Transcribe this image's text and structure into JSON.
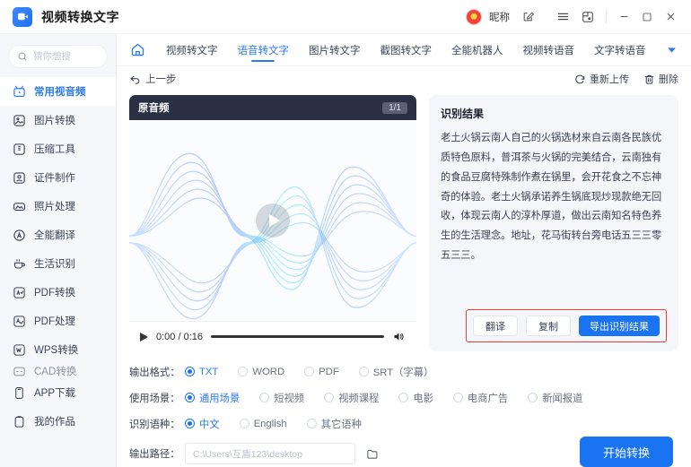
{
  "titlebar": {
    "app_title": "视频转换文字",
    "nickname": "昵称",
    "icons": [
      "edit-icon",
      "menu-icon",
      "window-snap-icon",
      "minimize-icon",
      "maximize-icon",
      "close-icon"
    ]
  },
  "sidebar": {
    "search": {
      "placeholder": "猜你想搜"
    },
    "items": [
      {
        "label": "常用视音频",
        "icon": "video-icon",
        "active": true
      },
      {
        "label": "图片转换",
        "icon": "image-icon",
        "active": false
      },
      {
        "label": "压缩工具",
        "icon": "compress-icon",
        "active": false
      },
      {
        "label": "证件制作",
        "icon": "id-card-icon",
        "active": false
      },
      {
        "label": "照片处理",
        "icon": "photo-icon",
        "active": false
      },
      {
        "label": "全能翻译",
        "icon": "translate-icon",
        "active": false
      },
      {
        "label": "生活识别",
        "icon": "life-icon",
        "active": false
      },
      {
        "label": "PDF转换",
        "icon": "pdf-convert-icon",
        "active": false
      },
      {
        "label": "PDF处理",
        "icon": "pdf-edit-icon",
        "active": false
      },
      {
        "label": "WPS转换",
        "icon": "wps-icon",
        "active": false
      },
      {
        "label": "CAD转换",
        "icon": "cad-icon",
        "active": false
      },
      {
        "label": "APP下载",
        "icon": "app-download-icon",
        "active": false
      },
      {
        "label": "我的作品",
        "icon": "my-works-icon",
        "active": false
      }
    ]
  },
  "tabs": [
    {
      "label": "视频转文字",
      "active": false
    },
    {
      "label": "语音转文字",
      "active": true
    },
    {
      "label": "图片转文字",
      "active": false
    },
    {
      "label": "截图转文字",
      "active": false
    },
    {
      "label": "全能机器人",
      "active": false
    },
    {
      "label": "视频转语音",
      "active": false
    },
    {
      "label": "文字转语音",
      "active": false
    }
  ],
  "toolbar": {
    "back_label": "上一步",
    "reupload_label": "重新上传",
    "delete_label": "删除"
  },
  "media": {
    "panel_title": "原音频",
    "page_indicator": "1/1",
    "current_time": "0:00",
    "duration": "0:16",
    "time_display": "0:00 / 0:16"
  },
  "result": {
    "title": "识别结果",
    "text": "老土火锅云南人自己的火锅选材来自云南各民族优质特色原料，普洱茶与火锅的完美结合，云南独有的食品豆腐特殊制作煮在锅里，会开花食之不忘神奇的体验。老土火锅承诺养生锅底现炒现款绝无回收，体现云南人的淳朴厚道，做出云南知名特色养生的生活理念。地址，花马街转台旁电话五三三零五三三。",
    "translate_label": "翻译",
    "copy_label": "复制",
    "export_label": "导出识别结果"
  },
  "options": {
    "format": {
      "label": "输出格式：",
      "choices": [
        "TXT",
        "WORD",
        "PDF",
        "SRT（字幕）"
      ],
      "selected": "TXT"
    },
    "scene": {
      "label": "使用场景：",
      "choices": [
        "通用场景",
        "短视频",
        "视频课程",
        "电影",
        "电商广告",
        "新闻报道"
      ],
      "selected": "通用场景"
    },
    "language": {
      "label": "识别语种：",
      "choices": [
        "中文",
        "English",
        "其它语种"
      ],
      "selected": "中文"
    },
    "output_path": {
      "label": "输出路径：",
      "value": "C:\\Users\\互盾123\\desktop"
    }
  },
  "start_button": {
    "label": "开始转换"
  },
  "colors": {
    "accent": "#1a73f0",
    "accent_text": "#2b7bf3",
    "panel_dark": "#2b3144",
    "highlight_box": "#ef3b3b",
    "sidebar_bg": "#f5f7fb",
    "result_bg": "#f4f6f9"
  }
}
